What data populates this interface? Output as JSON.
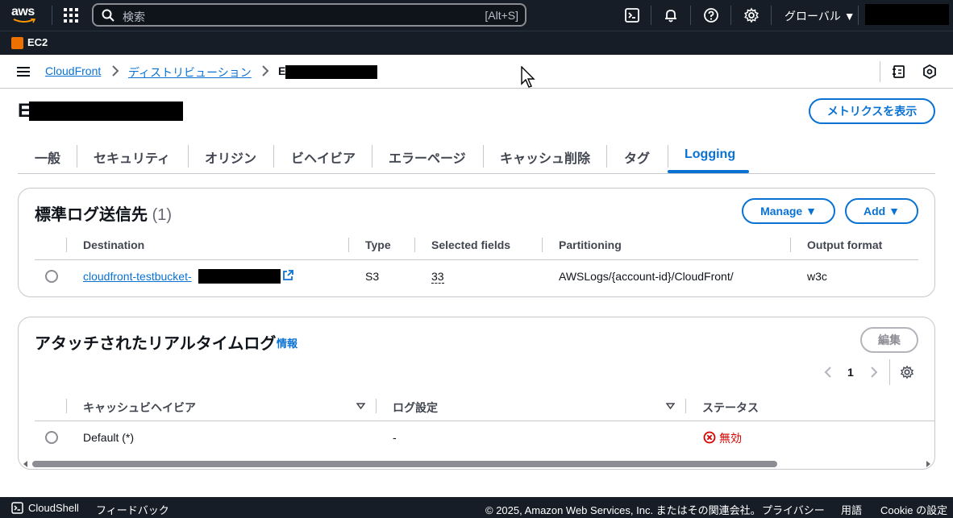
{
  "topbar": {
    "logo_text": "aws",
    "search": {
      "placeholder": "検索",
      "shortcut": "[Alt+S]"
    },
    "region": "グローバル ▼",
    "service": "EC2"
  },
  "breadcrumb": {
    "items": [
      "CloudFront",
      "ディストリビューション"
    ],
    "current": "E"
  },
  "page": {
    "title": "E",
    "metrics_button": "メトリクスを表示"
  },
  "tabs": [
    "一般",
    "セキュリティ",
    "オリジン",
    "ビヘイビア",
    "エラーページ",
    "キャッシュ削除",
    "タグ",
    "Logging"
  ],
  "active_tab": "Logging",
  "standard_logs": {
    "title": "標準ログ送信先",
    "count": "(1)",
    "manage_button": "Manage ▼",
    "add_button": "Add ▼",
    "columns": [
      "Destination",
      "Type",
      "Selected fields",
      "Partitioning",
      "Output format"
    ],
    "rows": [
      {
        "destination": "cloudfront-testbucket-",
        "type": "S3",
        "selected_fields": "33",
        "partitioning": "AWSLogs/{account-id}/CloudFront/",
        "output_format": "w3c"
      }
    ]
  },
  "realtime_logs": {
    "title": "アタッチされたリアルタイムログ",
    "info_link": "情報",
    "edit_button": "編集",
    "page_number": "1",
    "columns": [
      "キャッシュビヘイビア",
      "ログ設定",
      "ステータス"
    ],
    "rows": [
      {
        "behavior": "Default (*)",
        "log_config": "-",
        "status": "無効"
      }
    ]
  },
  "footer": {
    "cloudshell": "CloudShell",
    "feedback": "フィードバック",
    "copyright": "© 2025, Amazon Web Services, Inc. またはその関連会社。",
    "privacy": "プライバシー",
    "terms": "用語",
    "cookie": "Cookie の設定"
  },
  "colors": {
    "header_bg": "#161d26",
    "link": "#0972d3",
    "error": "#db0000",
    "border": "#c6c6cd"
  }
}
